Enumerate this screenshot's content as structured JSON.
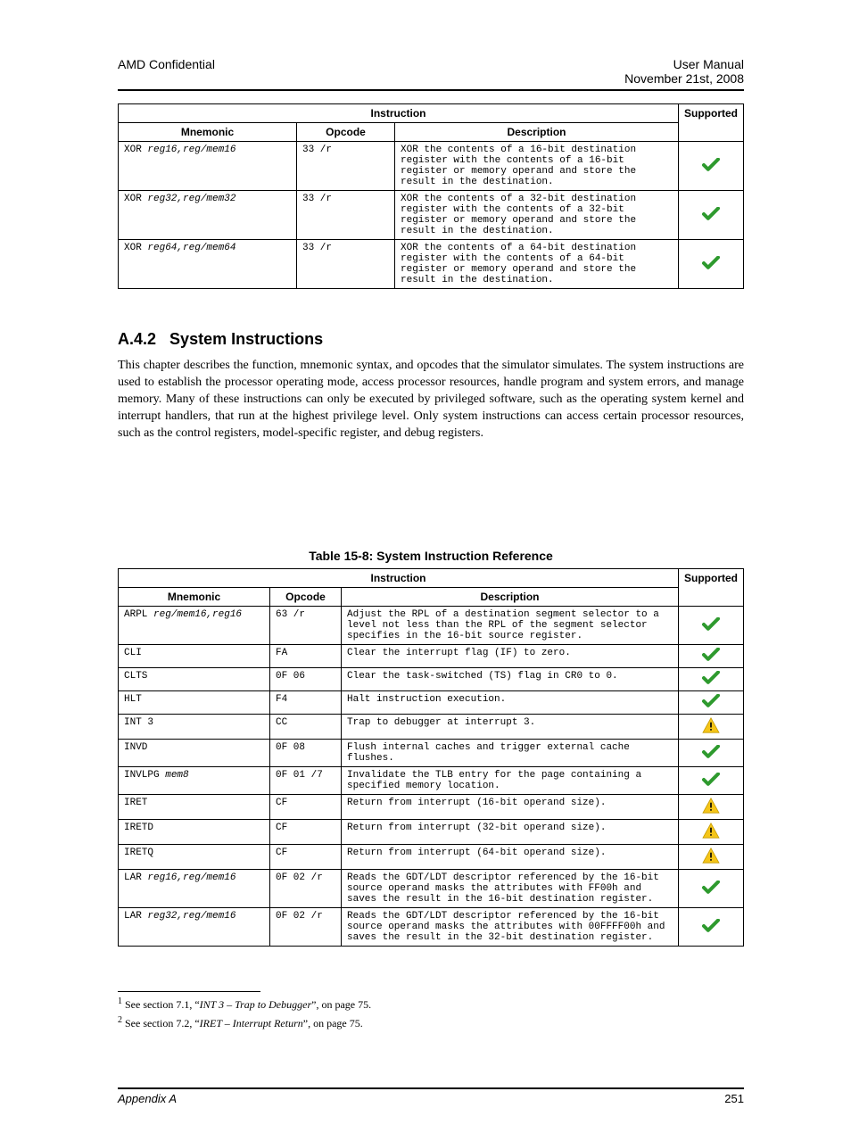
{
  "header": {
    "left": "AMD Confidential",
    "right_line1": "User Manual",
    "right_line2": "November 21st, 2008"
  },
  "table1": {
    "super_header": {
      "left_span": "Instruction",
      "right": "Supported"
    },
    "headers": {
      "mnemonic": "Mnemonic",
      "opcode": "Opcode",
      "description": "Description",
      "status": "Supported"
    },
    "rows": [
      {
        "mnemonic_pre": "XOR ",
        "mnemonic_args": "reg16,reg/mem16",
        "opcode": "33 /r",
        "description": "XOR the contents of a 16-bit destination register with the contents of a 16-bit register or memory operand and store the result in the destination.",
        "status": "check"
      },
      {
        "mnemonic_pre": "XOR ",
        "mnemonic_args": "reg32,reg/mem32",
        "opcode": "33 /r",
        "description": "XOR the contents of a 32-bit destination register with the contents of a 32-bit register or memory operand and store the result in the destination.",
        "status": "check"
      },
      {
        "mnemonic_pre": "XOR ",
        "mnemonic_args": "reg64,reg/mem64",
        "opcode": "33 /r",
        "description": "XOR the contents of a 64-bit destination register with the contents of a 64-bit register or memory operand and store the result in the destination.",
        "status": "check"
      }
    ]
  },
  "section": {
    "number": "A.4.2",
    "title": "System Instructions"
  },
  "body_sentence": "This chapter describes the function, mnemonic syntax, and opcodes that the simulator simulates. The system instructions are used to establish the processor operating mode, access processor resources, handle program and system errors, and manage memory. Many of these instructions can only be executed by privileged software, such as the operating system kernel and interrupt handlers, that run at the highest privilege level. Only system instructions can access certain processor resources, such as the control registers, model-specific register, and debug registers.",
  "table2": {
    "caption": "Table 15-8: System Instruction Reference",
    "super_header": {
      "left_span": "Instruction",
      "right": "Supported"
    },
    "headers": {
      "mnemonic": "Mnemonic",
      "opcode": "Opcode",
      "description": "Description",
      "status": "Supported"
    },
    "rows": [
      {
        "mnemonic_pre": "ARPL ",
        "mnemonic_args": "reg/mem16,reg16",
        "opcode": "63 /r",
        "description": "Adjust the RPL of a destination segment selector to a level not less than the RPL of the segment selector specifies in the 16-bit source register.",
        "status": "check"
      },
      {
        "mnemonic_pre": "CLI",
        "mnemonic_args": "",
        "opcode": "FA",
        "description": "Clear the interrupt flag (IF) to zero.",
        "status": "check"
      },
      {
        "mnemonic_pre": "CLTS",
        "mnemonic_args": "",
        "opcode": "0F 06",
        "description": "Clear the task-switched (TS) flag in CR0 to 0.",
        "status": "check"
      },
      {
        "mnemonic_pre": "HLT",
        "mnemonic_args": "",
        "opcode": "F4",
        "description": "Halt instruction execution.",
        "status": "check"
      },
      {
        "mnemonic_pre": "INT 3",
        "mnemonic_args": "",
        "opcode": "CC",
        "description": "Trap to debugger at interrupt 3.",
        "status": "warn"
      },
      {
        "mnemonic_pre": "INVD",
        "mnemonic_args": "",
        "opcode": "0F 08",
        "description": "Flush internal caches and trigger external cache flushes.",
        "status": "check"
      },
      {
        "mnemonic_pre": "INVLPG ",
        "mnemonic_args": "mem8",
        "opcode": "0F 01 /7",
        "description": "Invalidate the TLB entry for the page containing a specified memory location.",
        "status": "check"
      },
      {
        "mnemonic_pre": "IRET",
        "mnemonic_args": "",
        "opcode": "CF",
        "description": "Return from interrupt (16-bit operand size).",
        "status": "warn"
      },
      {
        "mnemonic_pre": "IRETD",
        "mnemonic_args": "",
        "opcode": "CF",
        "description": "Return from interrupt (32-bit operand size).",
        "status": "warn"
      },
      {
        "mnemonic_pre": "IRETQ",
        "mnemonic_args": "",
        "opcode": "CF",
        "description": "Return from interrupt (64-bit operand size).",
        "status": "warn"
      },
      {
        "mnemonic_pre": "LAR ",
        "mnemonic_args": "reg16,reg/mem16",
        "opcode": "0F 02 /r",
        "description": "Reads the GDT/LDT descriptor referenced by the 16-bit source operand masks the attributes with FF00h and saves the result in the 16-bit destination register.",
        "status": "check"
      },
      {
        "mnemonic_pre": "LAR ",
        "mnemonic_args": "reg32,reg/mem16",
        "opcode": "0F 02 /r",
        "description": "Reads the GDT/LDT descriptor referenced by the 16-bit source operand masks the attributes with 00FFFF00h and saves the result in the 32-bit destination register.",
        "status": "check"
      }
    ]
  },
  "footnotes": {
    "n1": {
      "sup": "1",
      "before": " See section ",
      "link": "7.1",
      "mid": ", “",
      "italic": "INT 3 – Trap to Debugger",
      "after": "”, on page ",
      "page": "75"
    },
    "n2": {
      "sup": "2",
      "before": " See section ",
      "link": "7.2",
      "mid": ", “",
      "italic": "IRET – Interrupt Return",
      "after": "”, on page ",
      "page": "75"
    }
  },
  "footer": {
    "left": "Appendix A",
    "page": "251"
  },
  "icons": {
    "check": "check-icon",
    "warn": "warn-icon"
  }
}
